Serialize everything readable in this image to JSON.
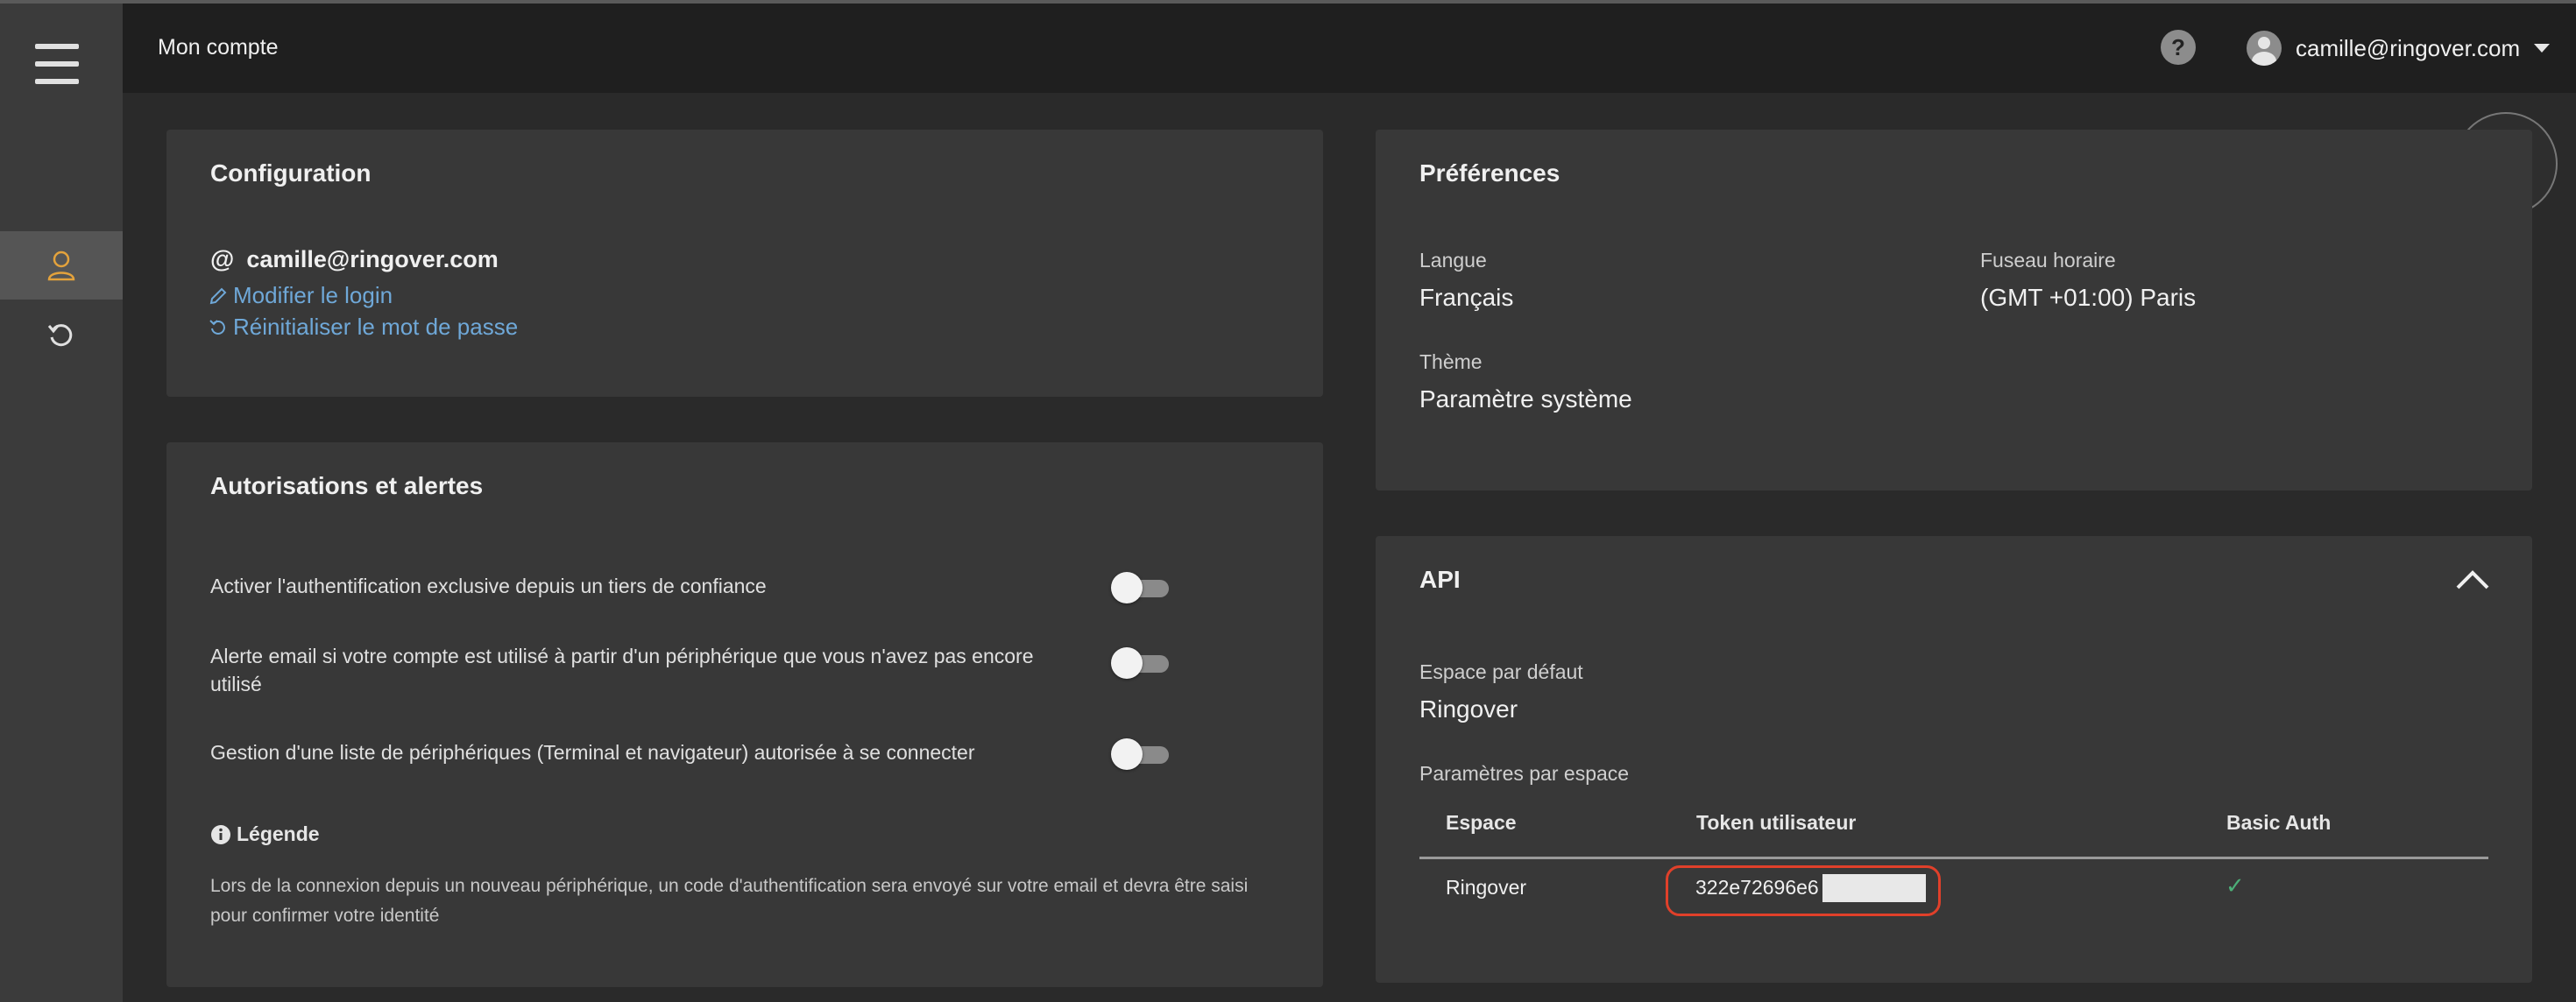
{
  "header": {
    "title": "Mon compte",
    "help_label": "?",
    "user_email": "camille@ringover.com"
  },
  "config": {
    "title": "Configuration",
    "at_symbol": "@",
    "email": "camille@ringover.com",
    "edit_login": "Modifier le login",
    "reset_password": "Réinitialiser le mot de passe"
  },
  "permissions": {
    "title": "Autorisations et alertes",
    "items": [
      {
        "label": "Activer l'authentification exclusive depuis un tiers de confiance",
        "enabled": false
      },
      {
        "label": "Alerte email si votre compte est utilisé à partir d'un périphérique que vous n'avez pas encore utilisé",
        "enabled": false
      },
      {
        "label": "Gestion d'une liste de périphériques (Terminal et navigateur) autorisée à se connecter",
        "enabled": false
      }
    ],
    "legend_title": "Légende",
    "legend_text": "Lors de la connexion depuis un nouveau périphérique, un code d'authentification sera envoyé sur votre email et devra être saisi pour confirmer votre identité"
  },
  "preferences": {
    "title": "Préférences",
    "language_label": "Langue",
    "language_value": "Français",
    "timezone_label": "Fuseau horaire",
    "timezone_value": "(GMT +01:00) Paris",
    "theme_label": "Thème",
    "theme_value": "Paramètre système"
  },
  "api": {
    "title": "API",
    "default_space_label": "Espace par défaut",
    "default_space_value": "Ringover",
    "per_space_label": "Paramètres par espace",
    "columns": [
      "Espace",
      "Token utilisateur",
      "Basic Auth"
    ],
    "rows": [
      {
        "space": "Ringover",
        "token": "322e72696e6",
        "basic_auth": "✓"
      }
    ]
  },
  "colors": {
    "link": "#6fa8d8",
    "accent": "#e3a23c",
    "check": "#4caf78",
    "highlight": "#e0402a"
  }
}
